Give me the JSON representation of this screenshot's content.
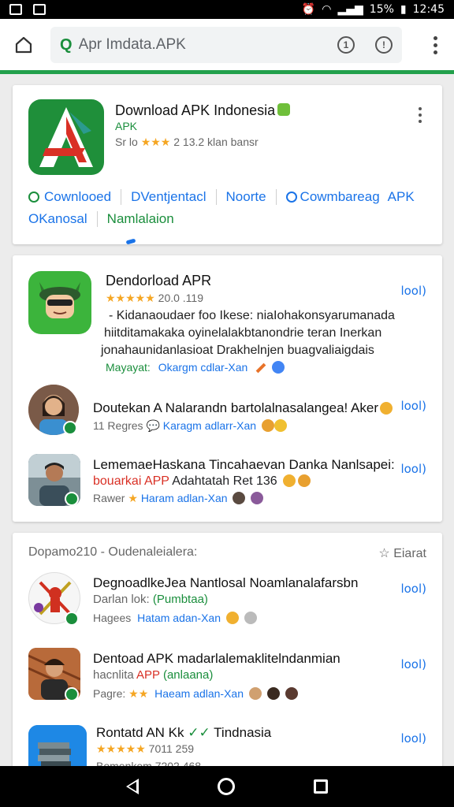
{
  "status_bar": {
    "signal_text": "15%",
    "time": "12:45"
  },
  "browser": {
    "url_prefix": "Q",
    "url": "Apr Imdata.APK"
  },
  "app_card": {
    "title": "Download APK Indonesia",
    "subtitle": "APK",
    "rating_prefix": "Sr lo",
    "stars": "★★★",
    "meta": "2 13.2 klan bansr",
    "tabs_row1": [
      "Cownlooed",
      "DVentjentacl",
      "Noorte",
      "Cowmbareag",
      "APK"
    ],
    "tabs_row2": [
      "OKanosal",
      "Namlalaion"
    ]
  },
  "card2": {
    "main": {
      "title": "Dendorload APR",
      "stars": "★★★★★",
      "rating": "20.0 .119",
      "description": [
        "- Kidanaoudaer foo Ikese: niaIohakonsyarumanada",
        "hiitditamakaka oyinelalakbtanondrie teran Inerkan",
        "jonahaunidanlasioat Drakhelnjen buagvaliaigdais"
      ],
      "tag_green": "Mayayat:",
      "tag_blue": "Okargm cdlar-Xan",
      "action": "lool)"
    },
    "items": [
      {
        "title": "Doutekan A Nalarandn bartolalnasalangea! Aker",
        "sub_prefix": "11 Regres",
        "sub_blue": "Karagm adlarr-Xan",
        "action": "lool)"
      },
      {
        "title": "LememaeHaskana Tincahaevan Danka Nanlsapei:",
        "sub_red": "bouarkai APP",
        "sub_rest": "Adahtatah Ret 136",
        "sub_prefix": "Rawer",
        "sub_blue": "Haram adlan-Xan",
        "action": "lool)"
      }
    ]
  },
  "card3": {
    "header": "Dopamo210 - Oudenaleialera:",
    "header_action": "Eiarat",
    "items": [
      {
        "title": "DegnoadlkeJea Nantlosal Noamlanalafarsbn",
        "sub_gray": "Darlan lok:",
        "sub_green": "(Pumbtaa)",
        "meta_prefix": "Hagees",
        "meta_blue": "Hatam adan-Xan",
        "action": "lool)"
      },
      {
        "title": "Dentoad APK madarlalemaklitelndanmian",
        "sub_gray": "hacnlita",
        "sub_red": "APP",
        "sub_green": "(anlaana)",
        "meta_prefix": "Pagre:",
        "meta_blue": "Haeam adlan-Xan",
        "action": "lool)"
      },
      {
        "title": "Rontatd AN Kk",
        "title_mid": "Tindnasia",
        "stars": "★★★★★",
        "rating": "7011 259",
        "meta_prefix": "Bomenkem 7202 468",
        "action": "lool)"
      }
    ]
  },
  "colors": {
    "accent_green": "#1a8e3c",
    "link_blue": "#1a73e8",
    "star": "#f5a623",
    "load_bar": "#22a04b"
  }
}
